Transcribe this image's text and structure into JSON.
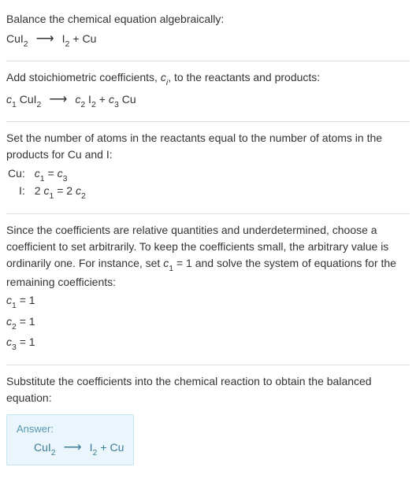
{
  "s1": {
    "intro": "Balance the chemical equation algebraically:",
    "r1": "CuI",
    "r1sub": "2",
    "arrow": "⟶",
    "p1": "I",
    "p1sub": "2",
    "plus": " + ",
    "p2": "Cu"
  },
  "s2": {
    "intro_a": "Add stoichiometric coefficients, ",
    "ci_c": "c",
    "ci_i": "i",
    "intro_b": ", to the reactants and products:",
    "c1": "c",
    "c1s": "1",
    "r1": " CuI",
    "r1sub": "2",
    "arrow": "⟶",
    "c2": "c",
    "c2s": "2",
    "p1": " I",
    "p1sub": "2",
    "plus": " + ",
    "c3": "c",
    "c3s": "3",
    "p2": " Cu"
  },
  "s3": {
    "intro": "Set the number of atoms in the reactants equal to the number of atoms in the products for Cu and I:",
    "row1label": "Cu:",
    "row2label": "I:",
    "r1_l_c": "c",
    "r1_l_s": "1",
    "r1_eq": " = ",
    "r1_r_c": "c",
    "r1_r_s": "3",
    "r2_l_num": "2 ",
    "r2_l_c": "c",
    "r2_l_s": "1",
    "r2_eq": " = ",
    "r2_r_num": "2 ",
    "r2_r_c": "c",
    "r2_r_s": "2"
  },
  "s4": {
    "intro_a": "Since the coefficients are relative quantities and underdetermined, choose a coefficient to set arbitrarily. To keep the coefficients small, the arbitrary value is ordinarily one. For instance, set ",
    "set_c": "c",
    "set_s": "1",
    "set_rest": " = 1",
    "intro_b": " and solve the system of equations for the remaining coefficients:",
    "l1_c": "c",
    "l1_s": "1",
    "l1_v": " = 1",
    "l2_c": "c",
    "l2_s": "2",
    "l2_v": " = 1",
    "l3_c": "c",
    "l3_s": "3",
    "l3_v": " = 1"
  },
  "s5": {
    "intro": "Substitute the coefficients into the chemical reaction to obtain the balanced equation:",
    "answer_label": "Answer:",
    "r1": "CuI",
    "r1sub": "2",
    "arrow": "⟶",
    "p1": "I",
    "p1sub": "2",
    "plus": " + ",
    "p2": "Cu"
  }
}
